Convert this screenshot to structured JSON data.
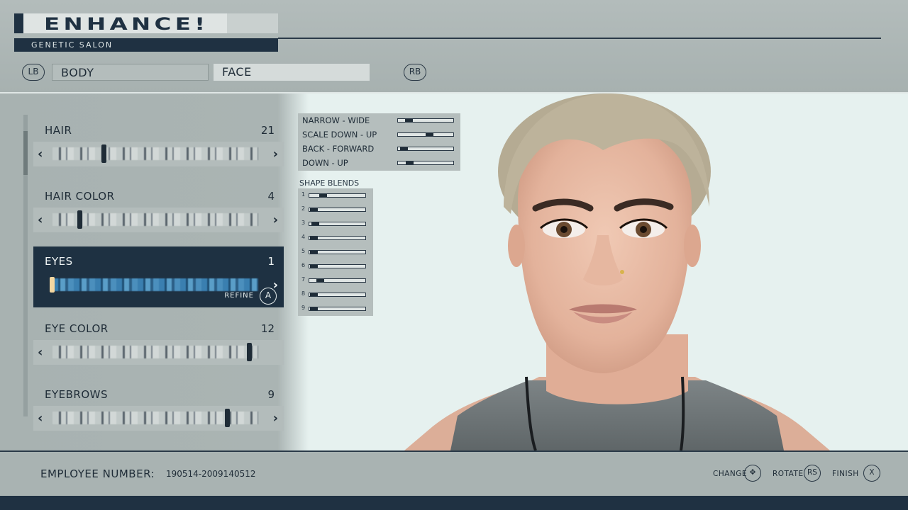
{
  "header": {
    "title": "ENHANCE!",
    "subtitle": "GENETIC SALON",
    "lb": "LB",
    "rb": "RB",
    "tabs": [
      {
        "label": "BODY",
        "selected": false
      },
      {
        "label": "FACE",
        "selected": true
      }
    ]
  },
  "features": [
    {
      "label": "HAIR",
      "value": "21"
    },
    {
      "label": "HAIR COLOR",
      "value": "4"
    },
    {
      "label": "EYES",
      "value": "1",
      "refine_label": "REFINE",
      "refine_button": "A"
    },
    {
      "label": "EYE COLOR",
      "value": "12"
    },
    {
      "label": "EYEBROWS",
      "value": "9"
    }
  ],
  "sliders": [
    {
      "label": "NARROW - WIDE",
      "level": 0.15
    },
    {
      "label": "SCALE DOWN - UP",
      "level": 0.58
    },
    {
      "label": "BACK - FORWARD",
      "level": 0.05
    },
    {
      "label": "DOWN - UP",
      "level": 0.17
    }
  ],
  "shape_blends": {
    "title": "SHAPE BLENDS",
    "items": [
      {
        "label": "1",
        "level": 0.2
      },
      {
        "label": "2",
        "level": 0.02
      },
      {
        "label": "3",
        "level": 0.05
      },
      {
        "label": "4",
        "level": 0.02
      },
      {
        "label": "5",
        "level": 0.02
      },
      {
        "label": "6",
        "level": 0.02
      },
      {
        "label": "7",
        "level": 0.15
      },
      {
        "label": "8",
        "level": 0.02
      },
      {
        "label": "9",
        "level": 0.02
      }
    ]
  },
  "footer": {
    "employee_label": "EMPLOYEE NUMBER:",
    "employee_number": "190514-2009140512",
    "hints": [
      {
        "label": "CHANGE",
        "button": "✥"
      },
      {
        "label": "ROTATE",
        "button": "RS"
      },
      {
        "label": "FINISH",
        "button": "X"
      }
    ]
  },
  "colors": {
    "navy": "#1f3142",
    "panel": "#a9b3b2",
    "viewport": "#e6f1ef"
  }
}
